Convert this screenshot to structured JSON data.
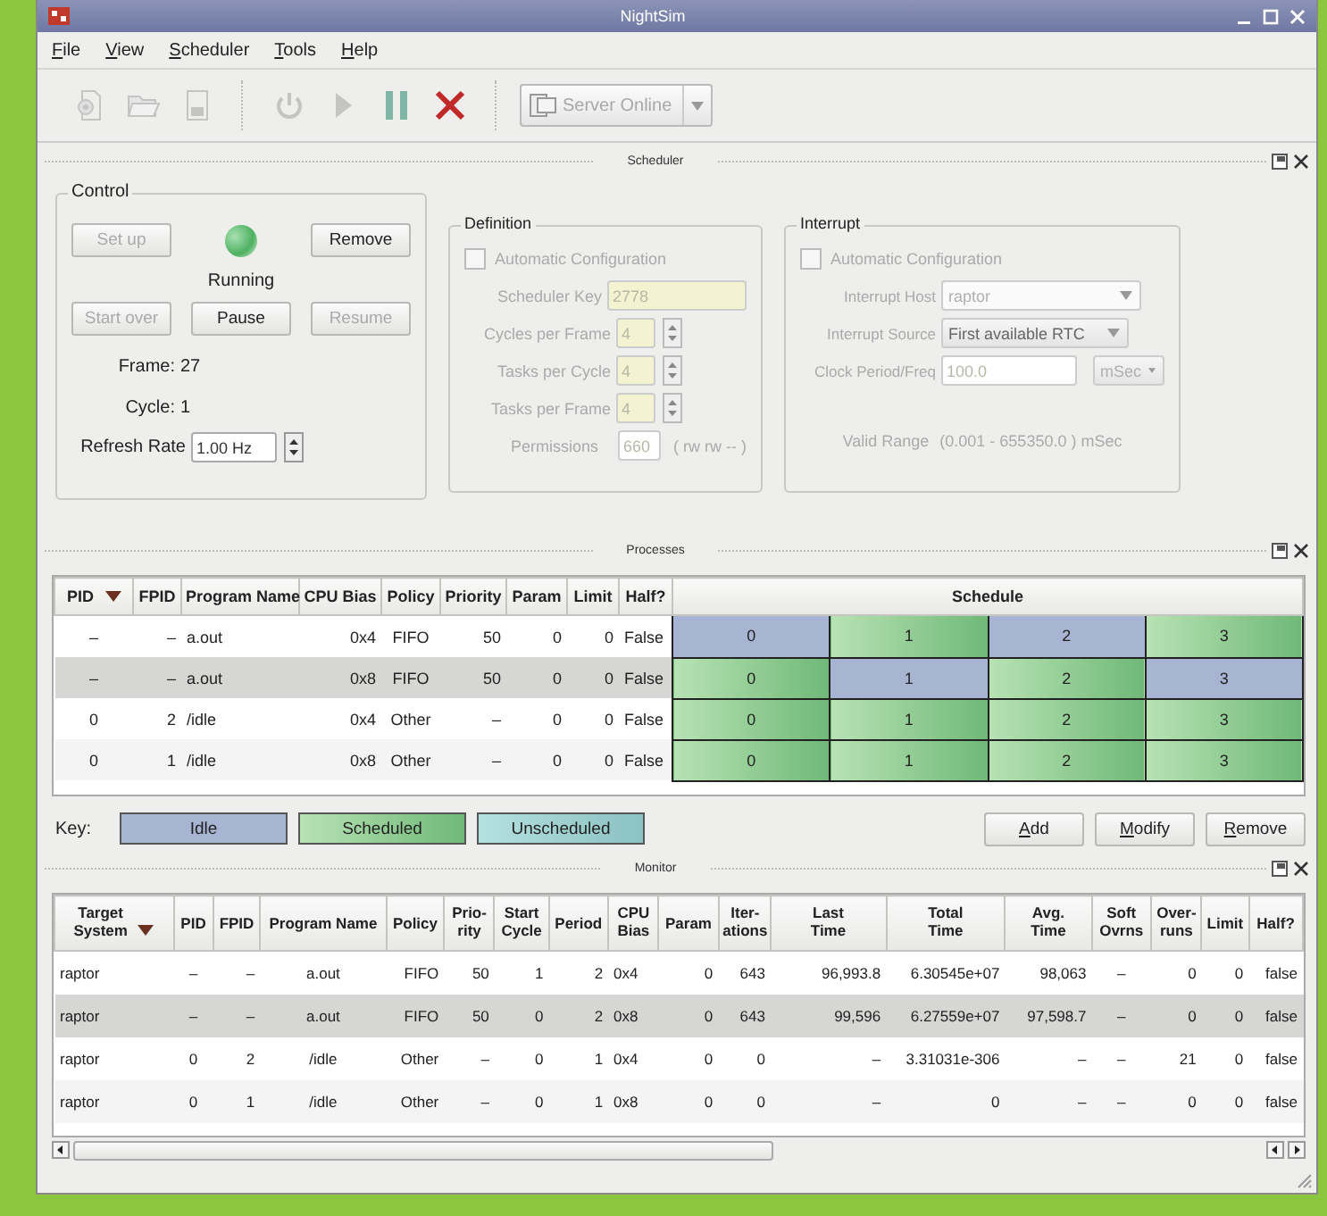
{
  "window": {
    "title": "NightSim"
  },
  "menu": [
    "File",
    "View",
    "Scheduler",
    "Tools",
    "Help"
  ],
  "toolbar": [
    {
      "kind": "config",
      "disabled": true
    },
    {
      "kind": "open",
      "disabled": true
    },
    {
      "kind": "save",
      "disabled": true
    },
    {
      "kind": "power",
      "disabled": true
    },
    {
      "kind": "play",
      "disabled": true
    },
    {
      "kind": "pause",
      "disabled": false
    },
    {
      "kind": "stop",
      "disabled": false
    }
  ],
  "server_button": {
    "label": "Server Online",
    "disabled": true
  },
  "scheduler": {
    "title": "Scheduler",
    "control": {
      "title": "Control",
      "running": true,
      "status": "Running",
      "buttons": [
        {
          "label": "Set up",
          "disabled": true
        },
        {
          "label": "Remove",
          "disabled": false
        },
        {
          "label": "Start over",
          "disabled": true
        },
        {
          "label": "Pause",
          "disabled": false
        },
        {
          "label": "Resume",
          "disabled": true
        }
      ],
      "readouts": [
        {
          "label": "Frame:",
          "value": "27"
        },
        {
          "label": "Cycle:",
          "value": "1"
        }
      ],
      "refresh": {
        "label": "Refresh Rate",
        "value": "1.00 Hz"
      }
    },
    "definition": {
      "title": "Definition",
      "disabled": true,
      "auto_config": {
        "label": "Automatic Configuration",
        "checked": false
      },
      "fields": [
        {
          "kind": "text",
          "label": "Scheduler Key",
          "value": "2778"
        },
        {
          "kind": "spin",
          "label": "Cycles per Frame",
          "value": "4"
        },
        {
          "kind": "spin",
          "label": "Tasks per Cycle",
          "value": "4"
        },
        {
          "kind": "spin",
          "label": "Tasks per Frame",
          "value": "4"
        },
        {
          "kind": "short",
          "label": "Permissions",
          "value": "660",
          "suffix": "( rw rw -- )"
        }
      ]
    },
    "interrupt": {
      "title": "Interrupt",
      "disabled": true,
      "auto_config": {
        "label": "Automatic Configuration",
        "checked": false
      },
      "fields": [
        {
          "kind": "edit-combo",
          "label": "Interrupt Host",
          "value": "raptor"
        },
        {
          "kind": "combo",
          "label": "Interrupt Source",
          "value": "First available RTC"
        },
        {
          "kind": "unit",
          "label": "Clock Period/Freq",
          "value": "100.0",
          "unit": "mSec"
        }
      ],
      "valid_range": {
        "label": "Valid Range",
        "value": "(0.001 - 655350.0 ) mSec"
      }
    }
  },
  "processes": {
    "title": "Processes",
    "columns": [
      {
        "label": "PID",
        "sorted": true
      },
      {
        "label": "FPID",
        "sorted": false
      },
      {
        "label": "Program Name",
        "sorted": false
      },
      {
        "label": "CPU Bias",
        "sorted": false
      },
      {
        "label": "Policy",
        "sorted": false
      },
      {
        "label": "Priority",
        "sorted": false
      },
      {
        "label": "Param",
        "sorted": false
      },
      {
        "label": "Limit",
        "sorted": false
      },
      {
        "label": "Half?",
        "sorted": false
      },
      {
        "label": "Schedule",
        "sorted": false
      }
    ],
    "rows": [
      {
        "selected": false,
        "cells": [
          "–",
          "–",
          "a.out",
          "0x4",
          "FIFO",
          "50",
          "0",
          "0",
          "False"
        ],
        "schedule": [
          {
            "label": "0",
            "kind": "idle"
          },
          {
            "label": "1",
            "kind": "scheduled"
          },
          {
            "label": "2",
            "kind": "idle"
          },
          {
            "label": "3",
            "kind": "scheduled"
          }
        ]
      },
      {
        "selected": true,
        "cells": [
          "–",
          "–",
          "a.out",
          "0x8",
          "FIFO",
          "50",
          "0",
          "0",
          "False"
        ],
        "schedule": [
          {
            "label": "0",
            "kind": "scheduled"
          },
          {
            "label": "1",
            "kind": "idle"
          },
          {
            "label": "2",
            "kind": "scheduled"
          },
          {
            "label": "3",
            "kind": "idle"
          }
        ]
      },
      {
        "selected": false,
        "cells": [
          "0",
          "2",
          "/idle",
          "0x4",
          "Other",
          "–",
          "0",
          "0",
          "False"
        ],
        "schedule": [
          {
            "label": "0",
            "kind": "scheduled"
          },
          {
            "label": "1",
            "kind": "scheduled"
          },
          {
            "label": "2",
            "kind": "scheduled"
          },
          {
            "label": "3",
            "kind": "scheduled"
          }
        ]
      },
      {
        "selected": false,
        "cells": [
          "0",
          "1",
          "/idle",
          "0x8",
          "Other",
          "–",
          "0",
          "0",
          "False"
        ],
        "schedule": [
          {
            "label": "0",
            "kind": "scheduled"
          },
          {
            "label": "1",
            "kind": "scheduled"
          },
          {
            "label": "2",
            "kind": "scheduled"
          },
          {
            "label": "3",
            "kind": "scheduled"
          }
        ]
      }
    ],
    "key_label": "Key:",
    "key": [
      {
        "label": "Idle",
        "kind": "idle"
      },
      {
        "label": "Scheduled",
        "kind": "scheduled"
      },
      {
        "label": "Unscheduled",
        "kind": "unscheduled"
      }
    ],
    "buttons": [
      "Add",
      "Modify",
      "Remove"
    ]
  },
  "monitor": {
    "title": "Monitor",
    "columns": [
      {
        "label": "Target\nSystem",
        "sorted": true
      },
      {
        "label": "PID",
        "sorted": false
      },
      {
        "label": "FPID",
        "sorted": false
      },
      {
        "label": "Program Name",
        "sorted": false
      },
      {
        "label": "Policy",
        "sorted": false
      },
      {
        "label": "Prio-\nrity",
        "sorted": false
      },
      {
        "label": "Start\nCycle",
        "sorted": false
      },
      {
        "label": "Period",
        "sorted": false
      },
      {
        "label": "CPU\nBias",
        "sorted": false
      },
      {
        "label": "Param",
        "sorted": false
      },
      {
        "label": "Iter-\nations",
        "sorted": false
      },
      {
        "label": "Last\nTime",
        "sorted": false
      },
      {
        "label": "Total\nTime",
        "sorted": false
      },
      {
        "label": "Avg.\nTime",
        "sorted": false
      },
      {
        "label": "Soft\nOvrns",
        "sorted": false
      },
      {
        "label": "Over-\nruns",
        "sorted": false
      },
      {
        "label": "Limit",
        "sorted": false
      },
      {
        "label": "Half?",
        "sorted": false
      }
    ],
    "rows": [
      {
        "selected": false,
        "cells": [
          "raptor",
          "–",
          "–",
          "a.out",
          "FIFO",
          "50",
          "1",
          "2",
          "0x4",
          "0",
          "643",
          "96,993.8",
          "6.30545e+07",
          "98,063",
          "–",
          "0",
          "0",
          "false"
        ]
      },
      {
        "selected": true,
        "cells": [
          "raptor",
          "–",
          "–",
          "a.out",
          "FIFO",
          "50",
          "0",
          "2",
          "0x8",
          "0",
          "643",
          "99,596",
          "6.27559e+07",
          "97,598.7",
          "–",
          "0",
          "0",
          "false"
        ]
      },
      {
        "selected": false,
        "cells": [
          "raptor",
          "0",
          "2",
          "/idle",
          "Other",
          "–",
          "0",
          "1",
          "0x4",
          "0",
          "0",
          "–",
          "3.31031e-306",
          "–",
          "–",
          "21",
          "0",
          "false"
        ]
      },
      {
        "selected": false,
        "cells": [
          "raptor",
          "0",
          "1",
          "/idle",
          "Other",
          "–",
          "0",
          "1",
          "0x8",
          "0",
          "0",
          "–",
          "0",
          "–",
          "–",
          "0",
          "0",
          "false"
        ]
      }
    ]
  }
}
